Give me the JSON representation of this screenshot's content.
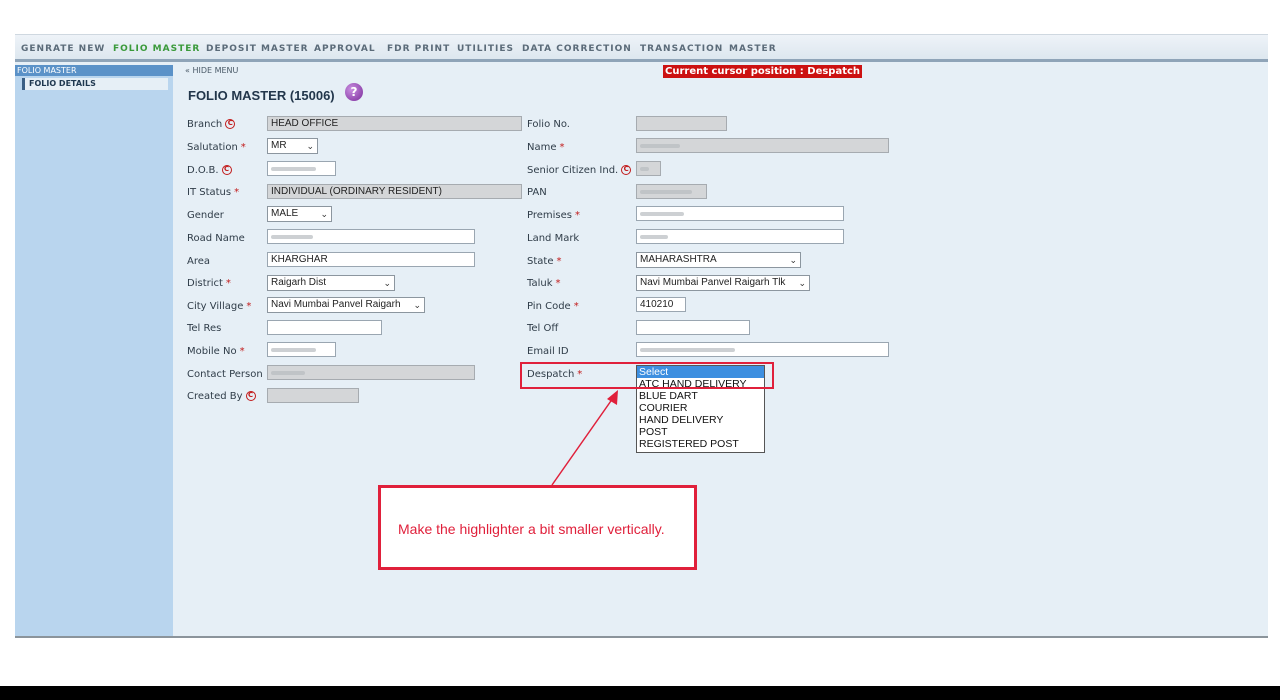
{
  "menu": {
    "items": [
      "GENRATE NEW",
      "FOLIO MASTER",
      "DEPOSIT MASTER",
      "APPROVAL",
      "FDR PRINT",
      "UTILITIES",
      "DATA CORRECTION",
      "TRANSACTION",
      "MASTER"
    ],
    "active": "FOLIO MASTER"
  },
  "sidebar": {
    "header": "FOLIO MASTER",
    "items": [
      "FOLIO DETAILS"
    ]
  },
  "hide_menu": "« HIDE MENU",
  "cursor_position": "Current cursor position : Despatch",
  "page_title": "FOLIO MASTER (15006)",
  "help_icon_text": "?",
  "left_fields": {
    "branch": {
      "label": "Branch",
      "value": "HEAD OFFICE"
    },
    "salutation": {
      "label": "Salutation",
      "value": "MR"
    },
    "dob": {
      "label": "D.O.B."
    },
    "it_status": {
      "label": "IT Status",
      "value": "INDIVIDUAL (ORDINARY RESIDENT)"
    },
    "gender": {
      "label": "Gender",
      "value": "MALE"
    },
    "road_name": {
      "label": "Road Name"
    },
    "area": {
      "label": "Area",
      "value": "KHARGHAR"
    },
    "district": {
      "label": "District",
      "value": "Raigarh Dist"
    },
    "city_village": {
      "label": "City Village",
      "value": "Navi Mumbai Panvel Raigarh"
    },
    "tel_res": {
      "label": "Tel Res"
    },
    "mobile_no": {
      "label": "Mobile No"
    },
    "contact_person": {
      "label": "Contact Person"
    },
    "created_by": {
      "label": "Created By"
    }
  },
  "right_fields": {
    "folio_no": {
      "label": "Folio No."
    },
    "name": {
      "label": "Name"
    },
    "senior_citizen": {
      "label": "Senior Citizen Ind."
    },
    "pan": {
      "label": "PAN"
    },
    "premises": {
      "label": "Premises"
    },
    "land_mark": {
      "label": "Land Mark"
    },
    "state": {
      "label": "State",
      "value": "MAHARASHTRA"
    },
    "taluk": {
      "label": "Taluk",
      "value": "Navi Mumbai Panvel Raigarh Tlk"
    },
    "pin_code": {
      "label": "Pin Code",
      "value": "410210"
    },
    "tel_off": {
      "label": "Tel Off"
    },
    "email_id": {
      "label": "Email ID"
    },
    "despatch": {
      "label": "Despatch"
    }
  },
  "required_marker": "*",
  "c_marker": "C",
  "select_arrow": "⌄",
  "despatch_options": [
    "Select",
    "ATC HAND DELIVERY",
    "BLUE DART",
    "COURIER",
    "HAND DELIVERY",
    "POST",
    "REGISTERED POST"
  ],
  "despatch_selected": "Select",
  "annotation": {
    "text": "Make the highlighter a bit smaller vertically.",
    "color": "#e0203b"
  },
  "colors": {
    "active_menu": "#3a9a3a",
    "required": "#c21a1a",
    "cursor_banner": "#cc1111",
    "list_selected": "#3d8fe0"
  }
}
